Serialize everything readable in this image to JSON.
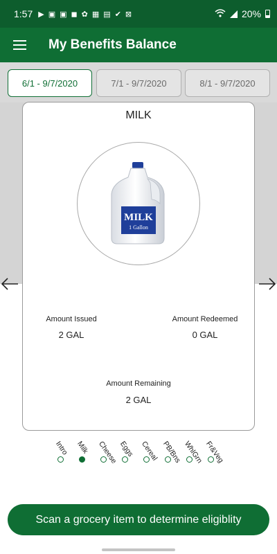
{
  "status_bar": {
    "time": "1:57",
    "battery": "20%"
  },
  "app_bar": {
    "title": "My Benefits Balance",
    "menu_icon": "hamburger-menu-icon"
  },
  "tabs": [
    {
      "label": "6/1 - 9/7/2020",
      "active": true
    },
    {
      "label": "7/1 - 9/7/2020",
      "active": false
    },
    {
      "label": "8/1 - 9/7/2020",
      "active": false
    }
  ],
  "card": {
    "title": "MILK",
    "jug": {
      "brand": "MILK",
      "size": "1 Gallon"
    },
    "amount_issued_label": "Amount Issued",
    "amount_issued_value": "2 GAL",
    "amount_redeemed_label": "Amount Redeemed",
    "amount_redeemed_value": "0 GAL",
    "amount_remaining_label": "Amount Remaining",
    "amount_remaining_value": "2 GAL"
  },
  "categories": [
    "Intro",
    "Milk",
    "Cheese",
    "Eggs",
    "Cereal",
    "PB/Bns",
    "WhlGrn",
    "Fr&Veg"
  ],
  "active_category_index": 1,
  "scan_button": {
    "label": "Scan a grocery item to determine eligiblity"
  },
  "colors": {
    "status_bar": "#0d5d2d",
    "primary_green": "#0f6e34",
    "tab_strip": "#d9d9d9",
    "carousel_bg": "#d4d4d4"
  }
}
